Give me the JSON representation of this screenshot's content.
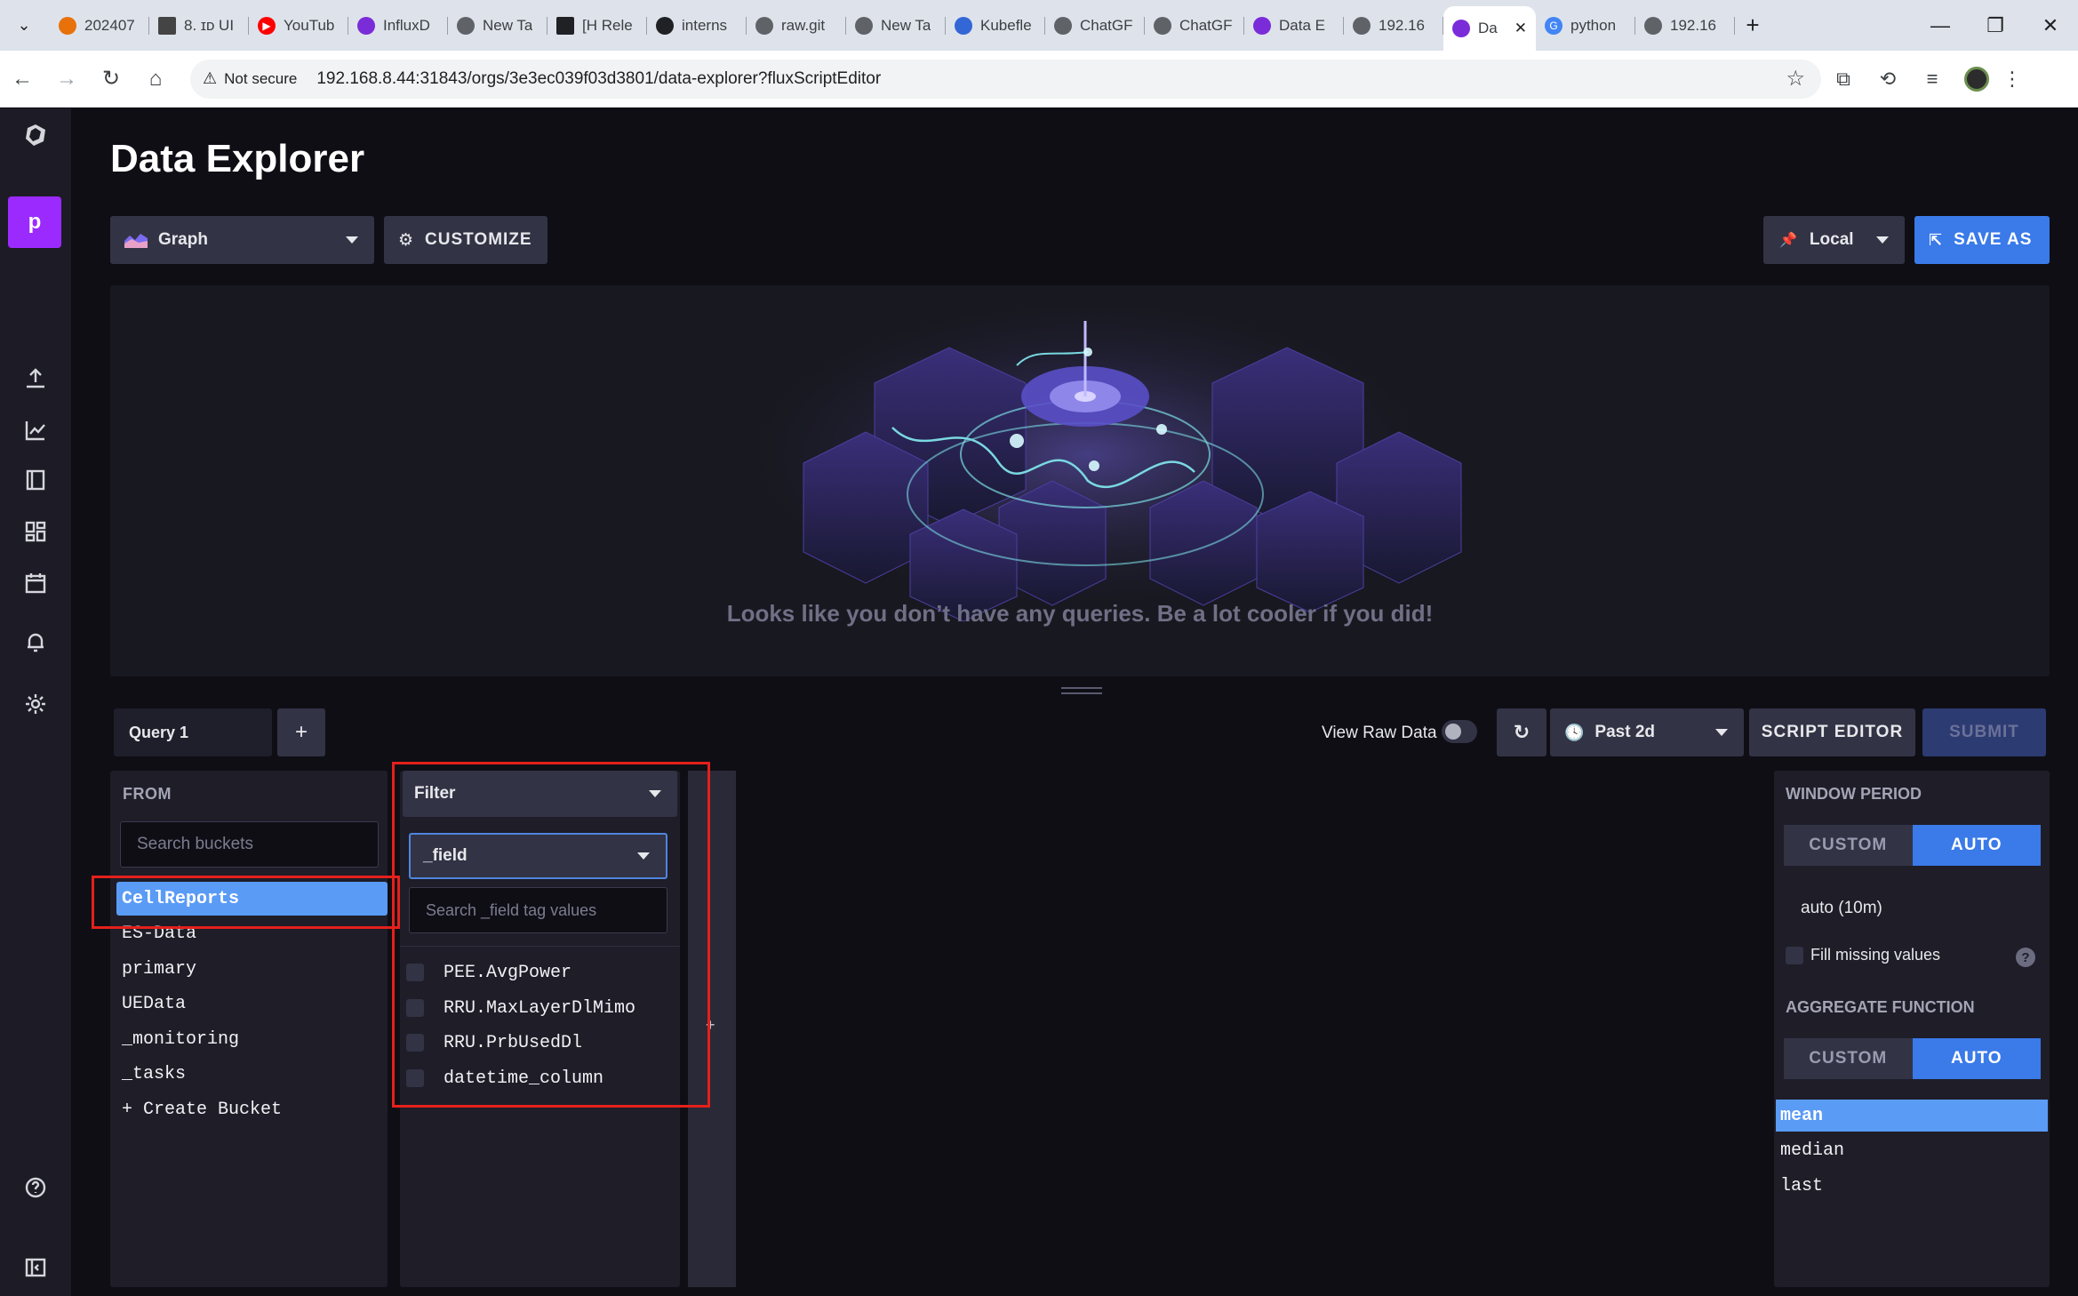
{
  "browser": {
    "tabs": [
      {
        "label": "202407",
        "color": "#e8710a"
      },
      {
        "label": "8. ɪᴅ UI",
        "color": "#444444"
      },
      {
        "label": "YouTub",
        "color": "#ff0000"
      },
      {
        "label": "InfluxD",
        "color": "#7b2cd9"
      },
      {
        "label": "New Ta",
        "color": "#5f6368"
      },
      {
        "label": "[H Rele",
        "color": "#202124"
      },
      {
        "label": "interns",
        "color": "#202124"
      },
      {
        "label": "raw.git",
        "color": "#5f6368"
      },
      {
        "label": "New Ta",
        "color": "#5f6368"
      },
      {
        "label": "Kubefle",
        "color": "#3367d6"
      },
      {
        "label": "ChatGF",
        "color": "#5f6368"
      },
      {
        "label": "ChatGF",
        "color": "#5f6368"
      },
      {
        "label": "Data E",
        "color": "#7b2cd9"
      },
      {
        "label": "192.16",
        "color": "#5f6368"
      },
      {
        "label": "Da",
        "color": "#7b2cd9",
        "active": true
      },
      {
        "label": "python",
        "color": "#4285f4"
      },
      {
        "label": "192.16",
        "color": "#5f6368"
      }
    ],
    "security_label": "Not secure",
    "url": "192.168.8.44:31843/orgs/3e3ec039f03d3801/data-explorer?fluxScriptEditor"
  },
  "sidebar": {
    "org_initial": "p",
    "items": [
      "influxdb-logo-icon",
      "upload-icon",
      "graph-icon",
      "notebook-icon",
      "dashboard-icon",
      "calendar-icon",
      "bell-icon",
      "settings-icon",
      "help-icon",
      "collapse-icon"
    ]
  },
  "header": {
    "title": "Data Explorer",
    "graph_type": "Graph",
    "customize_label": "CUSTOMIZE",
    "timezone": "Local",
    "save_as_label": "SAVE AS"
  },
  "graph": {
    "empty_message": "Looks like you don’t have any queries. Be a lot cooler if you did!"
  },
  "query_bar": {
    "query_tab": "Query 1",
    "add_label": "+",
    "view_raw_label": "View Raw Data",
    "view_raw_on": false,
    "time_range": "Past 2d",
    "script_editor_label": "SCRIPT EDITOR",
    "submit_label": "SUBMIT"
  },
  "from": {
    "title": "FROM",
    "search_placeholder": "Search buckets",
    "buckets": [
      "CellReports",
      "ES-Data",
      "primary",
      "UEData",
      "_monitoring",
      "_tasks",
      "+ Create Bucket"
    ],
    "selected": "CellReports"
  },
  "filter": {
    "title": "Filter",
    "key": "_field",
    "search_placeholder": "Search _field tag values",
    "values": [
      "PEE.AvgPower",
      "RRU.MaxLayerDlMimo",
      "RRU.PrbUsedDl",
      "datetime_column"
    ]
  },
  "add_column_label": "+",
  "window_period": {
    "title": "WINDOW PERIOD",
    "custom_label": "CUSTOM",
    "auto_label": "AUTO",
    "auto_value": "auto (10m)",
    "fill_missing_label": "Fill missing values",
    "help_label": "?"
  },
  "aggregate": {
    "title": "AGGREGATE FUNCTION",
    "custom_label": "CUSTOM",
    "auto_label": "AUTO",
    "functions": [
      "mean",
      "median",
      "last"
    ],
    "selected": "mean"
  },
  "colors": {
    "accent": "#3a7ae9",
    "selection": "#5a9bf6",
    "highlight": "#e5201b",
    "org": "#9b2aff"
  }
}
